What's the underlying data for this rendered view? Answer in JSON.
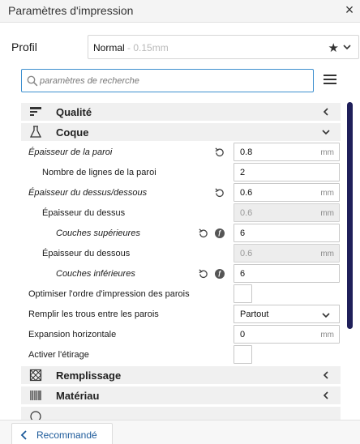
{
  "window": {
    "title": "Paramètres d'impression",
    "close_glyph": "×"
  },
  "profile": {
    "label": "Profil",
    "name": "Normal",
    "detail": " - 0.15mm"
  },
  "search": {
    "placeholder": "paramètres de recherche"
  },
  "sections": {
    "qualite": "Qualité",
    "coque": "Coque",
    "remplissage": "Remplissage",
    "materiau": "Matériau"
  },
  "settings": {
    "epaisseur_paroi": {
      "label": "Épaisseur de la paroi",
      "value": "0.8",
      "unit": "mm"
    },
    "nb_lignes_paroi": {
      "label": "Nombre de lignes de la paroi",
      "value": "2"
    },
    "epaisseur_dessus_dessous": {
      "label": "Épaisseur du dessus/dessous",
      "value": "0.6",
      "unit": "mm"
    },
    "epaisseur_dessus": {
      "label": "Épaisseur du dessus",
      "value": "0.6",
      "unit": "mm"
    },
    "couches_superieures": {
      "label": "Couches supérieures",
      "value": "6"
    },
    "epaisseur_dessous": {
      "label": "Épaisseur du dessous",
      "value": "0.6",
      "unit": "mm"
    },
    "couches_inferieures": {
      "label": "Couches inférieures",
      "value": "6"
    },
    "optimiser_ordre": {
      "label": "Optimiser l'ordre d'impression des parois",
      "checked": false
    },
    "remplir_trous": {
      "label": "Remplir les trous entre les parois",
      "value": "Partout"
    },
    "expansion_horizontale": {
      "label": "Expansion horizontale",
      "value": "0",
      "unit": "mm"
    },
    "activer_etirage": {
      "label": "Activer l'étirage",
      "checked": false
    }
  },
  "footer": {
    "recommended_label": "Recommandé"
  },
  "icons": {
    "close": "close-icon",
    "star": "star-icon",
    "chevron": "chevron-down-icon",
    "search": "search-icon",
    "menu": "hamburger-menu-icon",
    "reset": "reset-icon",
    "info": "function-info-icon"
  },
  "colors": {
    "accent": "#3d8fcf",
    "scrollbar": "#1f1f5a",
    "link": "#1c5a9a"
  }
}
